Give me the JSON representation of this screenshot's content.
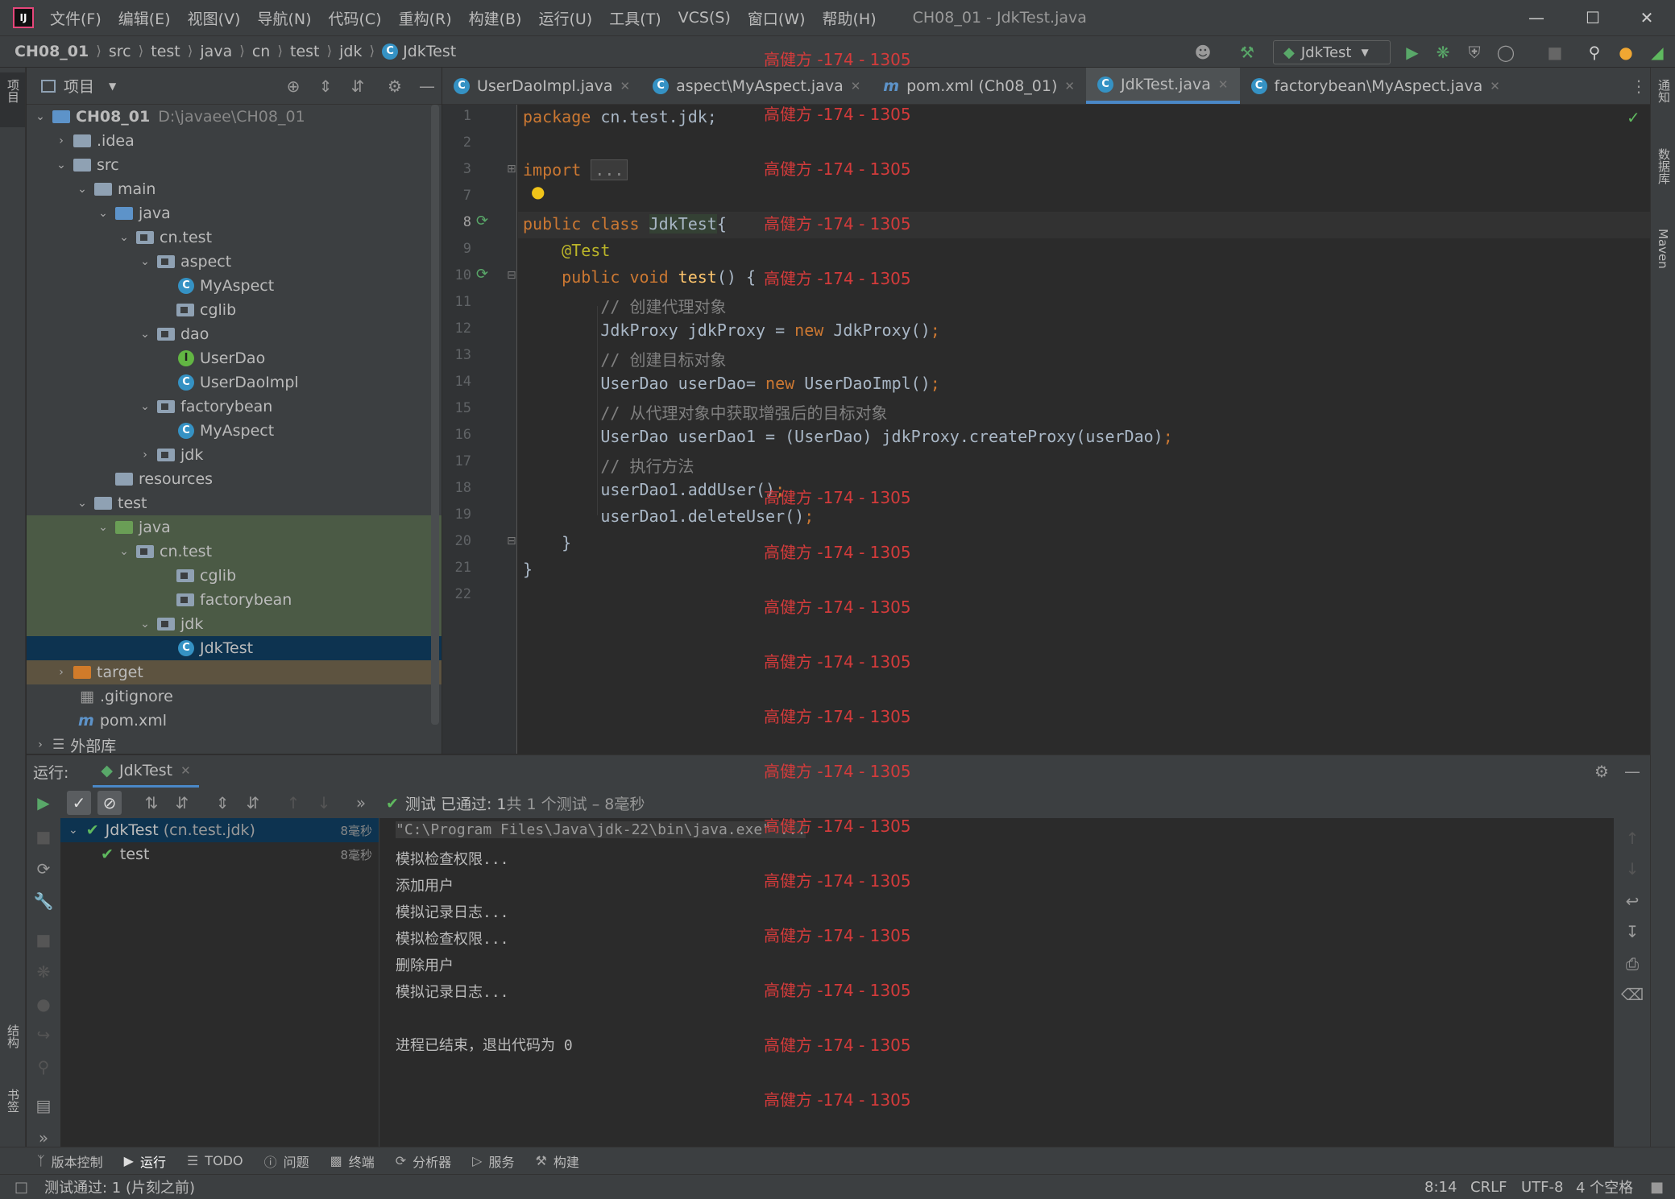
{
  "app": {
    "window_title": "CH08_01 - JdkTest.java",
    "logo": "IJ"
  },
  "menu": [
    "文件(F)",
    "编辑(E)",
    "视图(V)",
    "导航(N)",
    "代码(C)",
    "重构(R)",
    "构建(B)",
    "运行(U)",
    "工具(T)",
    "VCS(S)",
    "窗口(W)",
    "帮助(H)"
  ],
  "breadcrumb": [
    "CH08_01",
    "src",
    "test",
    "java",
    "cn",
    "test",
    "jdk",
    "JdkTest"
  ],
  "run_config": "JdkTest",
  "project_panel": {
    "title": "项目",
    "tree": [
      {
        "label": "CH08_01",
        "extra": "D:\\javaee\\CH08_01",
        "icon": "module-folder",
        "expanded": true
      },
      {
        "label": ".idea",
        "icon": "folder",
        "expanded": false
      },
      {
        "label": "src",
        "icon": "folder",
        "expanded": true
      },
      {
        "label": "main",
        "icon": "folder",
        "expanded": true
      },
      {
        "label": "java",
        "icon": "source-folder",
        "expanded": true
      },
      {
        "label": "cn.test",
        "icon": "package",
        "expanded": true
      },
      {
        "label": "aspect",
        "icon": "package",
        "expanded": true
      },
      {
        "label": "MyAspect",
        "icon": "class"
      },
      {
        "label": "cglib",
        "icon": "package"
      },
      {
        "label": "dao",
        "icon": "package",
        "expanded": true
      },
      {
        "label": "UserDao",
        "icon": "interface"
      },
      {
        "label": "UserDaoImpl",
        "icon": "class"
      },
      {
        "label": "factorybean",
        "icon": "package",
        "expanded": true
      },
      {
        "label": "MyAspect",
        "icon": "class"
      },
      {
        "label": "jdk",
        "icon": "package",
        "expanded": false
      },
      {
        "label": "resources",
        "icon": "resources-folder"
      },
      {
        "label": "test",
        "icon": "folder",
        "expanded": true
      },
      {
        "label": "java",
        "icon": "test-folder",
        "expanded": true
      },
      {
        "label": "cn.test",
        "icon": "package",
        "expanded": true
      },
      {
        "label": "cglib",
        "icon": "package"
      },
      {
        "label": "factorybean",
        "icon": "package"
      },
      {
        "label": "jdk",
        "icon": "package",
        "expanded": true
      },
      {
        "label": "JdkTest",
        "icon": "test-class",
        "selected": true
      },
      {
        "label": "target",
        "icon": "excluded-folder",
        "expanded": false
      },
      {
        "label": ".gitignore",
        "icon": "gitignore-file"
      },
      {
        "label": "pom.xml",
        "icon": "maven-file"
      },
      {
        "label": "外部库",
        "icon": "library",
        "expanded": false
      }
    ]
  },
  "editor_tabs": [
    {
      "label": "UserDaoImpl.java",
      "icon": "class"
    },
    {
      "label": "aspect\\MyAspect.java",
      "icon": "class"
    },
    {
      "label": "pom.xml (Ch08_01)",
      "icon": "maven-file"
    },
    {
      "label": "JdkTest.java",
      "icon": "test-class",
      "active": true
    },
    {
      "label": "factorybean\\MyAspect.java",
      "icon": "class"
    }
  ],
  "code": {
    "line_numbers": [
      "1",
      "2",
      "3",
      "7",
      "8",
      "9",
      "10",
      "11",
      "12",
      "13",
      "14",
      "15",
      "16",
      "17",
      "18",
      "19",
      "20",
      "21",
      "22"
    ],
    "lines": {
      "l1_kw": "package",
      "l1_rest": " cn.test.jdk;",
      "l3_kw": "import",
      "l3_fold": "...",
      "l8_kw": "public class",
      "l8_cls": "JdkTest",
      "l8_rest": "{",
      "l9_ann": "@Test",
      "l10_kw": "public void",
      "l10_fn": "test",
      "l10_rest": "() {",
      "l11": "// 创建代理对象",
      "l12_a": "JdkProxy jdkProxy = ",
      "l12_kw": "new",
      "l12_b": " JdkProxy()",
      "l13": "// 创建目标对象",
      "l14_a": "UserDao userDao= ",
      "l14_kw": "new",
      "l14_b": " UserDaoImpl()",
      "l15": "// 从代理对象中获取增强后的目标对象",
      "l16_a": "UserDao userDao1 = (UserDao) jdkProxy.createProxy(userDao)",
      "l18": "userDao1.addUser()",
      "l19": "userDao1.deleteUser()",
      "l20": "}",
      "l21": "}",
      "semi": ";"
    }
  },
  "watermark": "高健方 -174 - 1305",
  "run_panel": {
    "label": "运行:",
    "tab": "JdkTest",
    "status_passed": "测试 已通过: 1",
    "status_detail": "共 1 个测试 – 8毫秒",
    "tree": [
      {
        "label": "JdkTest",
        "suffix": "(cn.test.jdk)",
        "time": "8毫秒"
      },
      {
        "label": "test",
        "time": "8毫秒"
      }
    ],
    "console": [
      "\"C:\\Program Files\\Java\\jdk-22\\bin\\java.exe\" ...",
      "模拟检查权限...",
      "添加用户",
      "模拟记录日志...",
      "模拟检查权限...",
      "删除用户",
      "模拟记录日志...",
      "",
      "进程已结束，退出代码为 0"
    ]
  },
  "bottom_tabs": [
    {
      "label": "版本控制",
      "icon": "vcs-icon"
    },
    {
      "label": "运行",
      "icon": "run-icon",
      "active": true
    },
    {
      "label": "TODO",
      "icon": "todo-icon"
    },
    {
      "label": "问题",
      "icon": "problems-icon"
    },
    {
      "label": "终端",
      "icon": "terminal-icon"
    },
    {
      "label": "分析器",
      "icon": "profiler-icon"
    },
    {
      "label": "服务",
      "icon": "services-icon"
    },
    {
      "label": "构建",
      "icon": "build-icon"
    }
  ],
  "status_bar": {
    "message": "测试通过: 1 (片刻之前)",
    "position": "8:14",
    "line_sep": "CRLF",
    "encoding": "UTF-8",
    "indent": "4 个空格"
  },
  "side_labels": {
    "left_top": "项目",
    "left_structure": "结构",
    "left_bookmarks": "书签",
    "right_notifications": "通知",
    "right_database": "数据库",
    "right_maven": "Maven"
  },
  "colors": {
    "accent": "#4a88c7",
    "keyword": "#cc7832",
    "annotation": "#bbb529",
    "comment": "#808080",
    "function": "#ffc66d",
    "watermark": "#d43b3b",
    "pass": "#5fb95f"
  }
}
